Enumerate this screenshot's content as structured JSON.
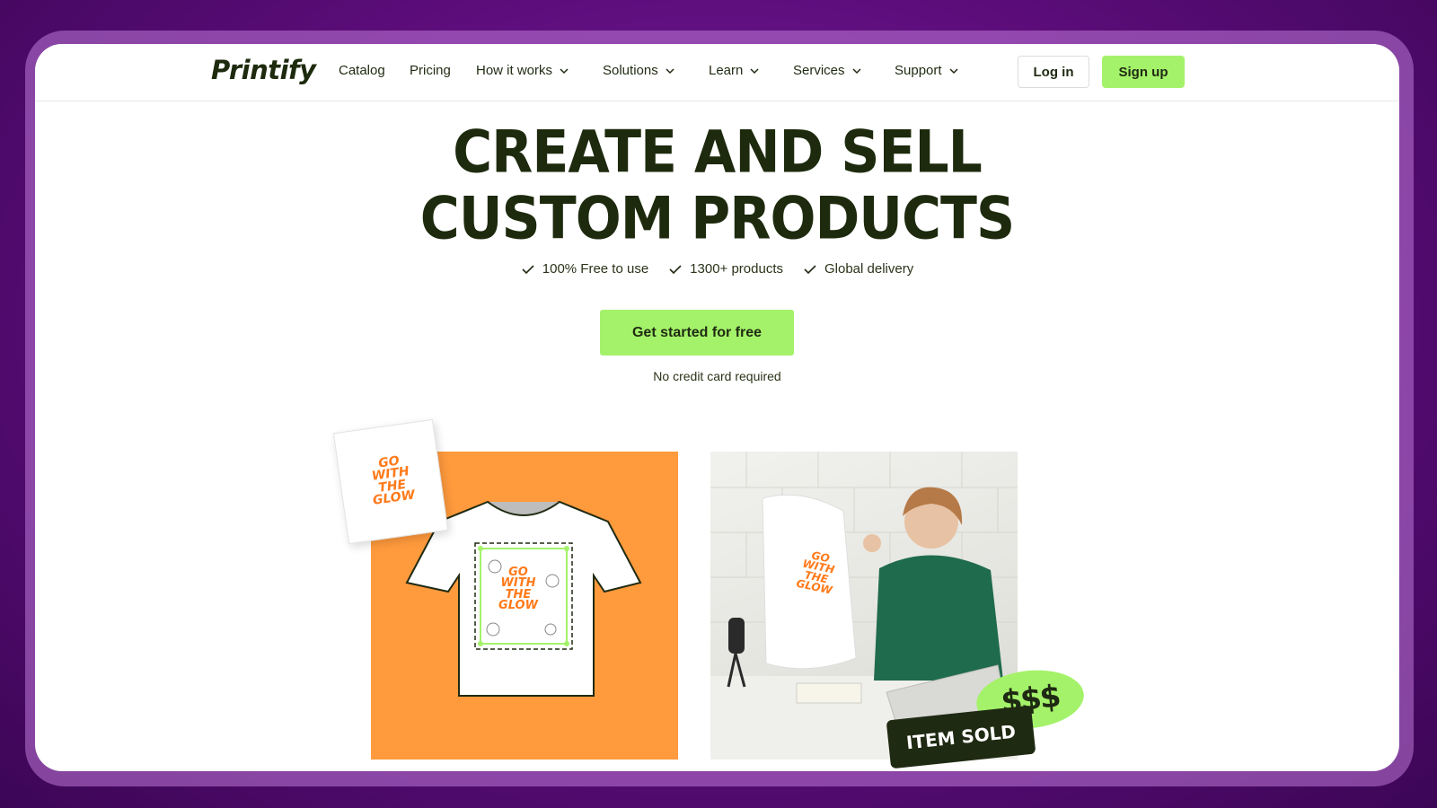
{
  "brand": {
    "logo_text": "Printify"
  },
  "nav": {
    "items": [
      {
        "label": "Catalog",
        "dropdown": false
      },
      {
        "label": "Pricing",
        "dropdown": false
      },
      {
        "label": "How it works",
        "dropdown": true
      },
      {
        "label": "Solutions",
        "dropdown": true
      },
      {
        "label": "Learn",
        "dropdown": true
      },
      {
        "label": "Services",
        "dropdown": true
      },
      {
        "label": "Support",
        "dropdown": true
      }
    ],
    "login_label": "Log in",
    "signup_label": "Sign up"
  },
  "hero": {
    "title_line1": "CREATE AND SELL",
    "title_line2": "CUSTOM PRODUCTS",
    "features": [
      "100% Free to use",
      "1300+ products",
      "Global delivery"
    ],
    "cta_label": "Get started for free",
    "note": "No credit card required"
  },
  "showcase": {
    "design_text": "GO WITH THE GLOW",
    "badge_money": "$$$",
    "badge_sold": "ITEM SOLD"
  },
  "colors": {
    "accent_green": "#a4f26a",
    "dark_text": "#1d2a0d",
    "orange": "#ff9a3d",
    "background_purple": "#5a0c78"
  }
}
